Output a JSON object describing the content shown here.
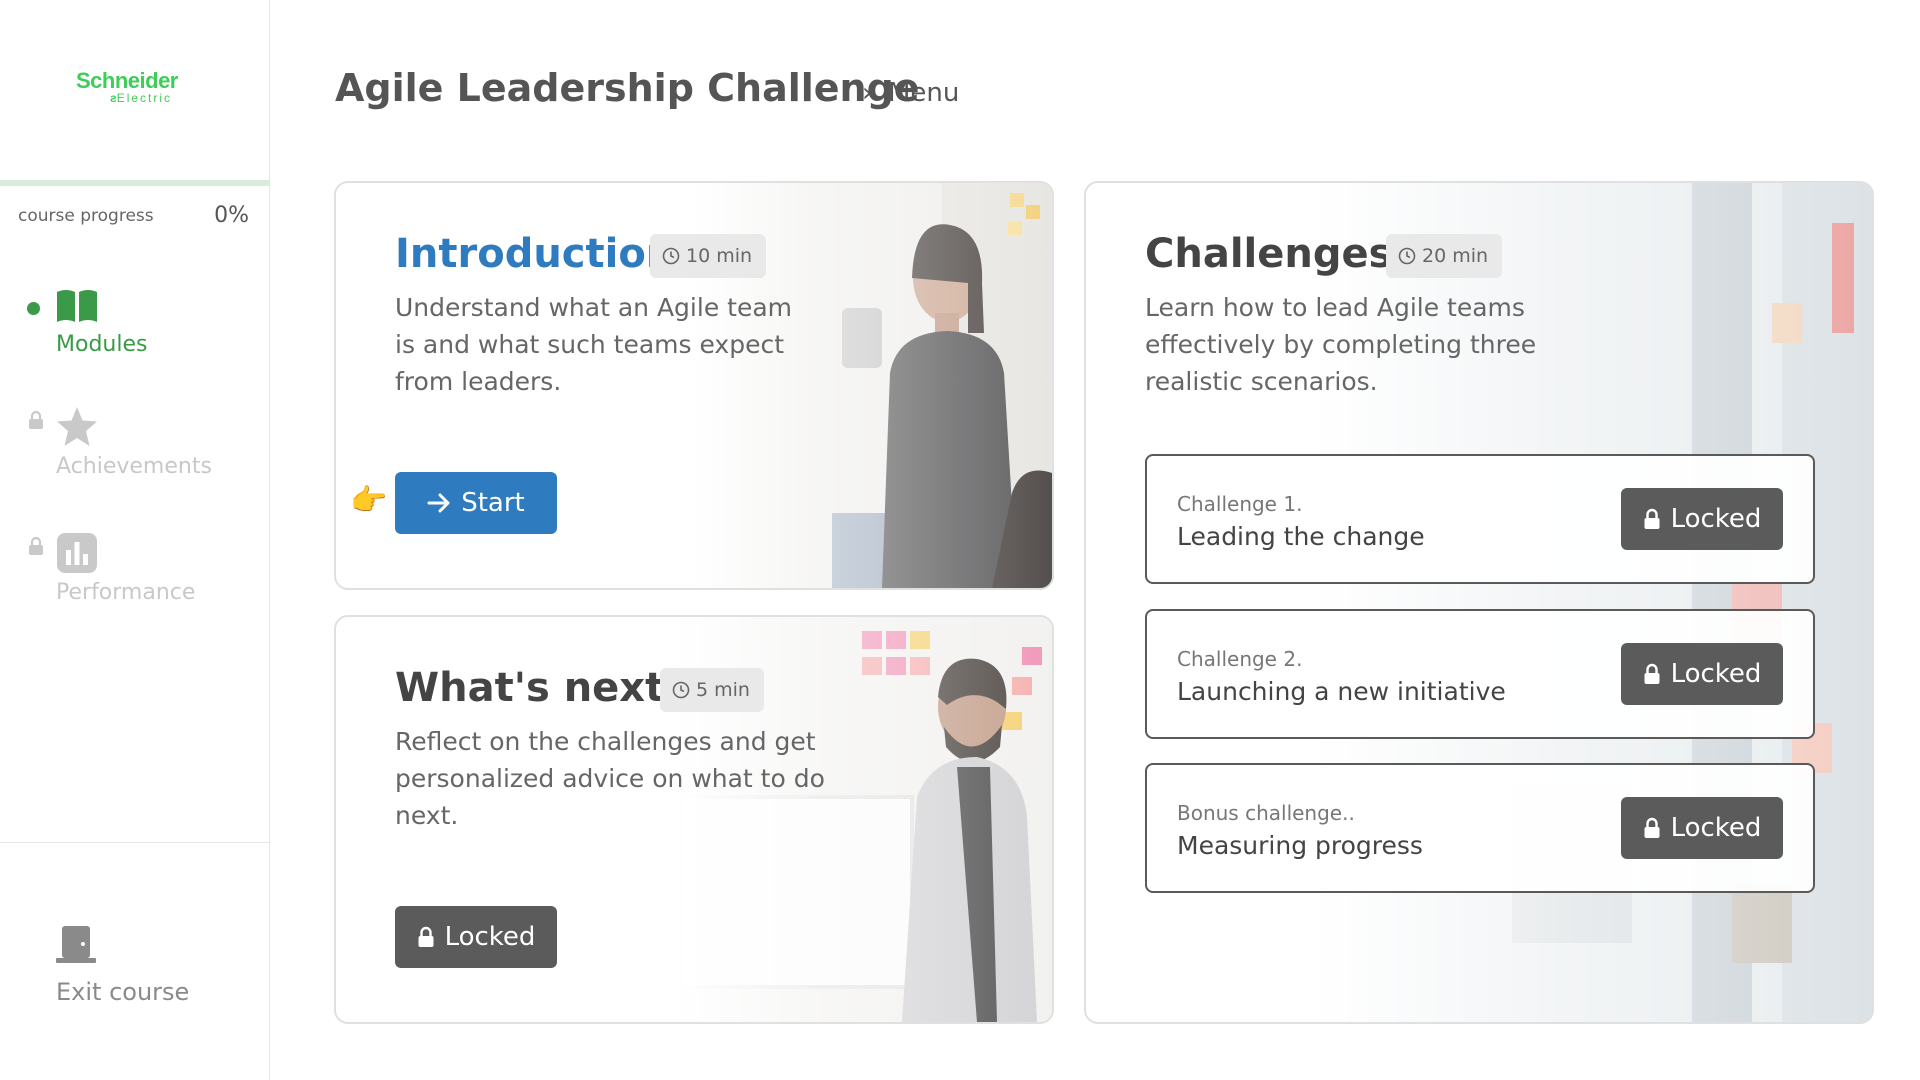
{
  "brand": {
    "logo_line1": "Schneider",
    "logo_line2": "Electric",
    "accent": "#3dcd58"
  },
  "sidebar": {
    "progress_label": "course progress",
    "progress_value": "0%",
    "progress_fraction": 0,
    "nav": [
      {
        "label": "Modules",
        "icon": "book-icon",
        "state": "active"
      },
      {
        "label": "Achievements",
        "icon": "star-icon",
        "state": "locked"
      },
      {
        "label": "Performance",
        "icon": "bar-chart-icon",
        "state": "locked"
      }
    ],
    "exit_label": "Exit course",
    "exit_icon": "door-icon"
  },
  "header": {
    "title": "Agile Leadership Challenge",
    "separator": "›",
    "breadcrumb": "Menu"
  },
  "cards": {
    "introduction": {
      "title": "Introduction",
      "time": "10 min",
      "description": "Understand what an Agile team is and what such teams expect from leaders.",
      "button_label": "Start",
      "pointer_icon": "👉",
      "title_color": "#2f7bbf"
    },
    "whats_next": {
      "title": "What's next",
      "time": "5 min",
      "description": "Reflect on the challenges and get personalized advice on what to do next.",
      "button_label": "Locked"
    },
    "challenges": {
      "title": "Challenges",
      "time": "20 min",
      "description": "Learn how to lead Agile teams effectively by completing three realistic scenarios.",
      "items": [
        {
          "kicker": "Challenge 1.",
          "name": "Leading the change",
          "button_label": "Locked"
        },
        {
          "kicker": "Challenge 2.",
          "name": "Launching a new initiative",
          "button_label": "Locked"
        },
        {
          "kicker": "Bonus challenge..",
          "name": "Measuring progress",
          "button_label": "Locked"
        }
      ]
    }
  }
}
